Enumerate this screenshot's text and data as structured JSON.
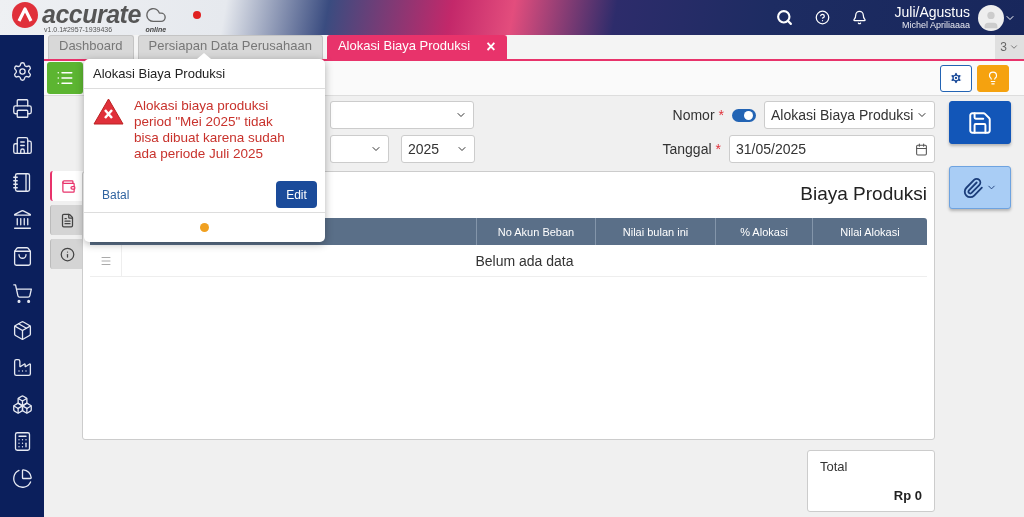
{
  "header": {
    "logo_text": "accurate",
    "logo_sub": "online",
    "version": "v1.0.1#2957-1939436",
    "period": "Juli/Agustus",
    "user_name": "Michel Apriliaaaa"
  },
  "tabs": [
    {
      "label": "Dashboard",
      "selected": false
    },
    {
      "label": "Persiapan Data Perusahaan",
      "selected": false
    },
    {
      "label": "Alokasi Biaya Produksi",
      "selected": true,
      "close": "×"
    }
  ],
  "tab_overflow": "3",
  "form": {
    "year": "2025",
    "nomor": {
      "label": "Nomor",
      "required_mark": "*",
      "auto": true,
      "value": "Alokasi Biaya Produksi"
    },
    "tanggal": {
      "label": "Tanggal",
      "required_mark": "*",
      "value": "31/05/2025"
    }
  },
  "side_tabs": [
    {
      "kind": "cost",
      "selected": true
    },
    {
      "kind": "document",
      "selected": false
    },
    {
      "kind": "info",
      "selected": false
    }
  ],
  "card": {
    "title": "Biaya Produksi",
    "columns": [
      "No Akun Beban",
      "Nilai bulan ini",
      "% Alokasi",
      "Nilai Alokasi"
    ],
    "empty_text": "Belum ada data"
  },
  "total": {
    "label": "Total",
    "value": "Rp 0"
  },
  "popover": {
    "title": "Alokasi Biaya Produksi",
    "message": "Alokasi biaya produksi period \"Mei 2025\" tidak bisa dibuat karena sudah ada periode Juli 2025",
    "cancel": "Batal",
    "confirm": "Edit"
  }
}
